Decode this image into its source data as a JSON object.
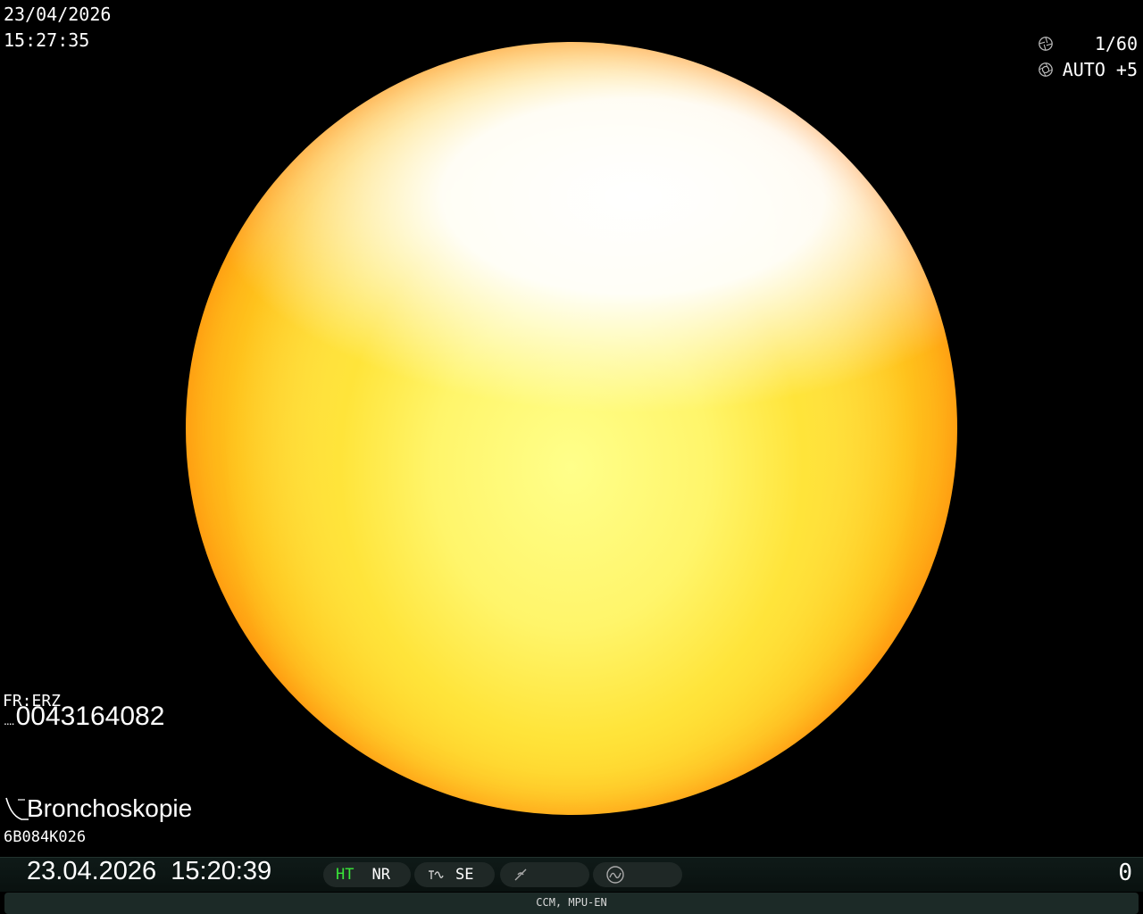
{
  "overlay": {
    "date": "23/04/2026",
    "time": "15:27:35"
  },
  "settings": {
    "shutter": {
      "icon": "shutter-icon",
      "value": "1/60"
    },
    "iris": {
      "icon": "iris-icon",
      "value": "AUTO +5"
    }
  },
  "patient": {
    "fr_label": "FR:ERZ",
    "id_prefix": "....",
    "id": "0043164082",
    "procedure": "Bronchoskopie",
    "procedure_icon": "bronchoscope-icon",
    "scope_serial": "6B084K026"
  },
  "status_bar": {
    "datetime": "23.04.2026  15:20:39",
    "modes": [
      {
        "label": "HT",
        "color": "#39e639"
      },
      {
        "label": "NR",
        "color": "#ffffff"
      }
    ],
    "structure_enhancement": {
      "icon": "structure-enhancement-icon",
      "label": "SE"
    },
    "color_icon": "color-tone-icon",
    "optical_icon": "optical-mode-icon",
    "counter": "0"
  },
  "info_bar": {
    "text": "CCM, MPU-EN"
  },
  "colors": {
    "background": "#000000",
    "status_bar": "#0f1a18",
    "pill": "#1f2826",
    "highlight_green": "#39e639",
    "scope_center": "#fff7b0",
    "scope_edge": "#ff5a00"
  }
}
